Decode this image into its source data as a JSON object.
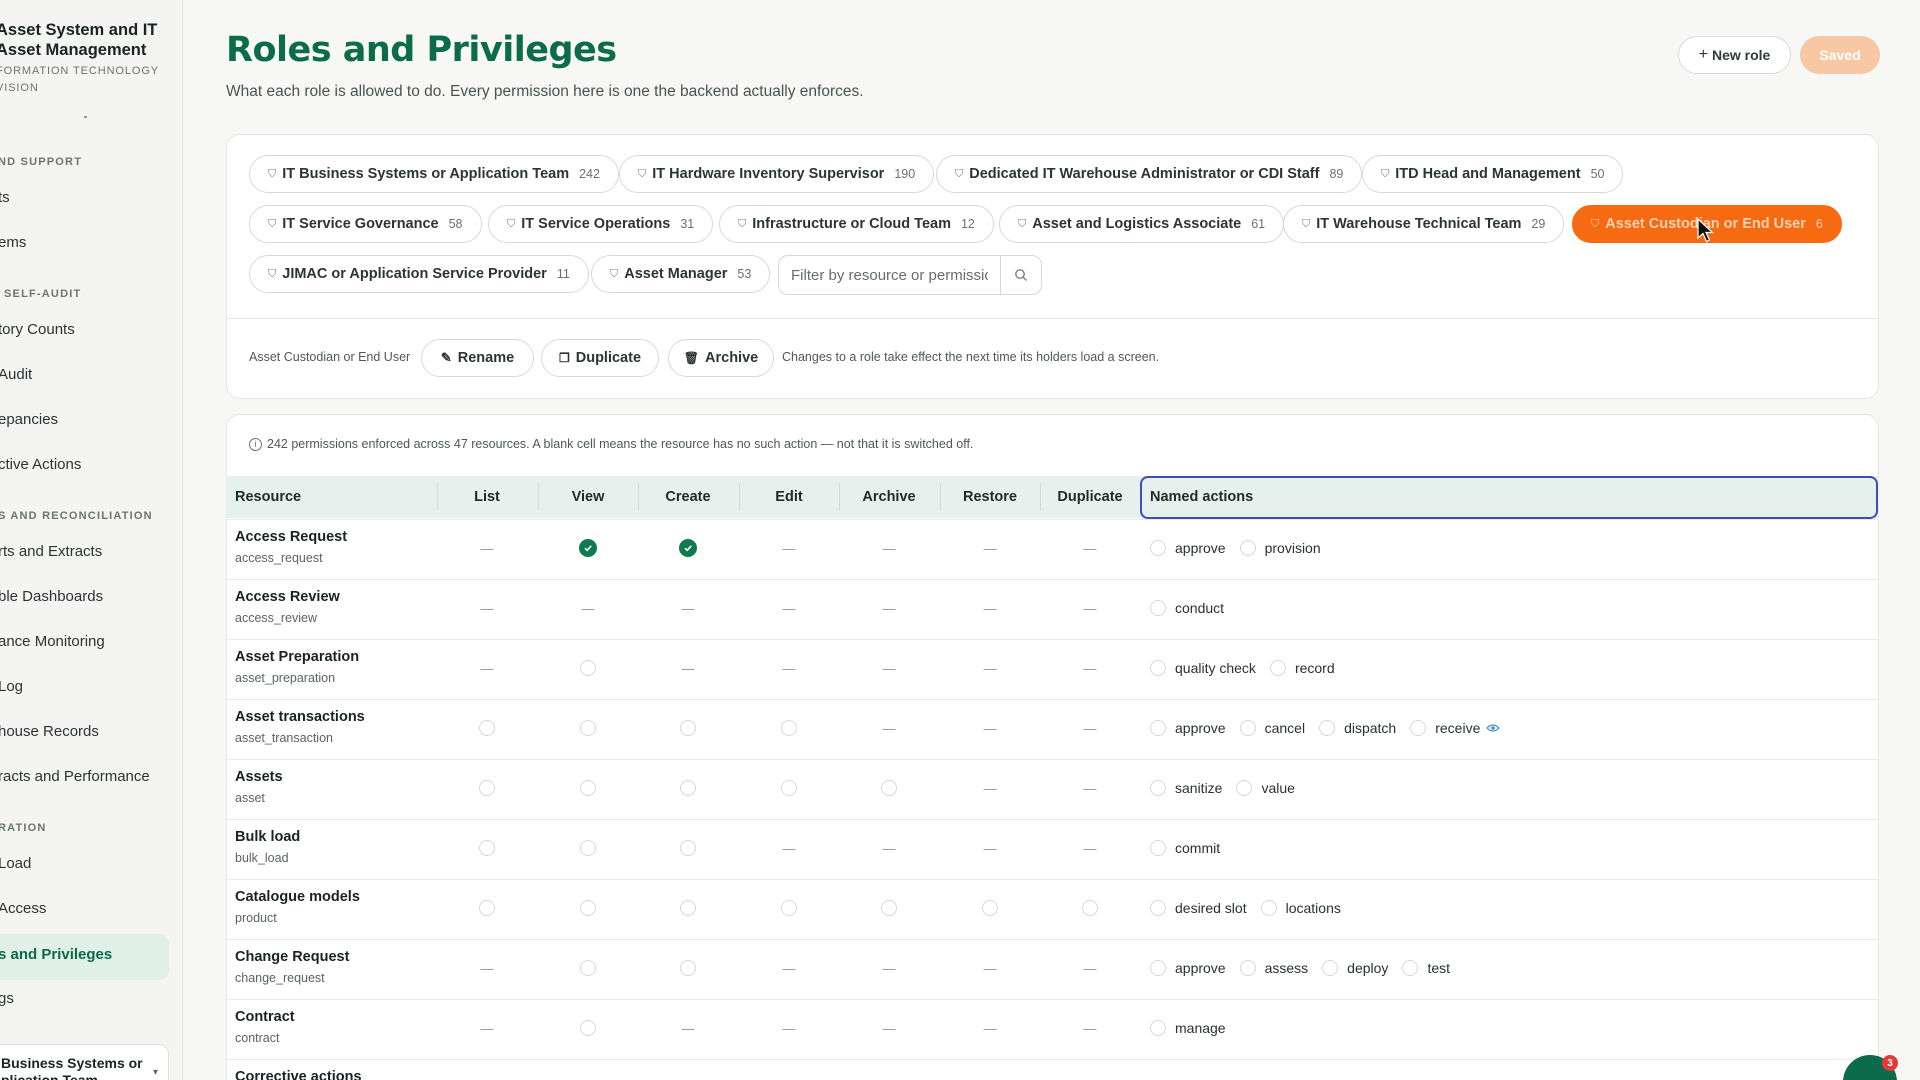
{
  "sidebar": {
    "brand_title": "Asset System and IT Asset Management",
    "brand_subtitle": "FORMATION TECHNOLOGY VISION",
    "sections": [
      {
        "heading": "ND SUPPORT",
        "items": [
          "ts",
          "ems"
        ]
      },
      {
        "heading": "SELF-AUDIT",
        "items": [
          "tory Counts",
          "Audit",
          "epancies",
          "ctive Actions"
        ]
      },
      {
        "heading": "S AND RECONCILIATION",
        "items": [
          "rts and Extracts",
          "ble Dashboards",
          "ance Monitoring",
          "Log",
          "house Records",
          "racts and Performance"
        ]
      },
      {
        "heading": "RATION",
        "items": [
          "Load",
          "Access",
          "s and Privileges",
          "gs"
        ]
      }
    ],
    "active_item": "s and Privileges",
    "current_role_card": "Business Systems or plication Team"
  },
  "header": {
    "title": "Roles and Privileges",
    "subtitle": "What each role is allowed to do. Every permission here is one the backend actually enforces.",
    "new_role_label": "New role",
    "saved_label": "Saved"
  },
  "roles": [
    {
      "name": "IT Business Systems or Application Team",
      "count": "242"
    },
    {
      "name": "IT Hardware Inventory Supervisor",
      "count": "190"
    },
    {
      "name": "Dedicated IT Warehouse Administrator or CDI Staff",
      "count": "89"
    },
    {
      "name": "ITD Head and Management",
      "count": "50"
    },
    {
      "name": "IT Service Governance",
      "count": "58"
    },
    {
      "name": "IT Service Operations",
      "count": "31"
    },
    {
      "name": "Infrastructure or Cloud Team",
      "count": "12"
    },
    {
      "name": "Asset and Logistics Associate",
      "count": "61"
    },
    {
      "name": "IT Warehouse Technical Team",
      "count": "29"
    },
    {
      "name": "Asset Custodian or End User",
      "count": "6"
    },
    {
      "name": "JIMAC or Application Service Provider",
      "count": "11"
    },
    {
      "name": "Asset Manager",
      "count": "53"
    }
  ],
  "filter": {
    "placeholder": "Filter by resource or permission"
  },
  "selected": {
    "role": "Asset Custodian or End User",
    "rename": "Rename",
    "duplicate": "Duplicate",
    "archive": "Archive",
    "note": "Changes to a role take effect the next time its holders load a screen."
  },
  "matrix": {
    "summary": "242 permissions enforced across 47 resources. A blank cell means the resource has no such action — not that it is switched off.",
    "columns": [
      "Resource",
      "List",
      "View",
      "Create",
      "Edit",
      "Archive",
      "Restore",
      "Duplicate",
      "Named actions"
    ],
    "dash": "—",
    "rows": [
      {
        "name": "Access Request",
        "key": "access_request",
        "cells": [
          "d",
          "c",
          "c",
          "d",
          "d",
          "d",
          "d"
        ],
        "named": [
          "approve",
          "provision"
        ]
      },
      {
        "name": "Access Review",
        "key": "access_review",
        "cells": [
          "d",
          "d",
          "d",
          "d",
          "d",
          "d",
          "d"
        ],
        "named": [
          "conduct"
        ]
      },
      {
        "name": "Asset Preparation",
        "key": "asset_preparation",
        "cells": [
          "d",
          "u",
          "d",
          "d",
          "d",
          "d",
          "d"
        ],
        "named": [
          "quality check",
          "record"
        ]
      },
      {
        "name": "Asset transactions",
        "key": "asset_transaction",
        "cells": [
          "u",
          "u",
          "u",
          "u",
          "d",
          "d",
          "d"
        ],
        "named": [
          "approve",
          "cancel",
          "dispatch",
          "receive"
        ]
      },
      {
        "name": "Assets",
        "key": "asset",
        "cells": [
          "u",
          "u",
          "u",
          "u",
          "u",
          "d",
          "d"
        ],
        "named": [
          "sanitize",
          "value"
        ]
      },
      {
        "name": "Bulk load",
        "key": "bulk_load",
        "cells": [
          "u",
          "u",
          "u",
          "d",
          "d",
          "d",
          "d"
        ],
        "named": [
          "commit"
        ]
      },
      {
        "name": "Catalogue models",
        "key": "product",
        "cells": [
          "u",
          "u",
          "u",
          "u",
          "u",
          "u",
          "u"
        ],
        "named": [
          "desired slot",
          "locations"
        ]
      },
      {
        "name": "Change Request",
        "key": "change_request",
        "cells": [
          "d",
          "u",
          "u",
          "d",
          "d",
          "d",
          "d"
        ],
        "named": [
          "approve",
          "assess",
          "deploy",
          "test"
        ]
      },
      {
        "name": "Contract",
        "key": "contract",
        "cells": [
          "d",
          "u",
          "d",
          "d",
          "d",
          "d",
          "d"
        ],
        "named": [
          "manage"
        ]
      },
      {
        "name": "Corrective actions",
        "key": "",
        "cells": [
          "",
          "",
          "",
          "",
          "",
          "",
          ""
        ],
        "named": []
      }
    ]
  },
  "fab": {
    "badge": "3"
  },
  "colors": {
    "brand": "#0b6b4b",
    "accent": "#f66a12",
    "check": "#0e7a4f"
  }
}
